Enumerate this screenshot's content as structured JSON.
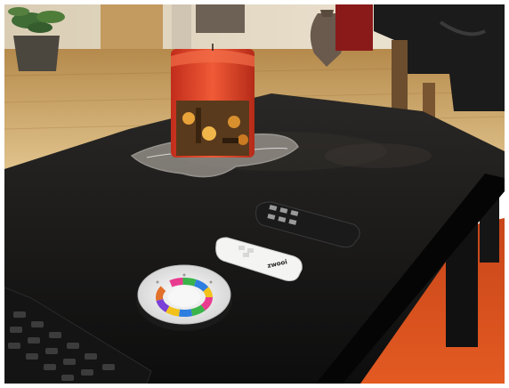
{
  "scene": {
    "remote_logo_text": "zwooi"
  },
  "colors": {
    "table": "#141414",
    "floor": "#c9a25e",
    "candle": "#e5452c",
    "rug": "#d94c1c"
  },
  "icons": [
    "candle",
    "glass-plate",
    "color-wheel-remote",
    "white-remote",
    "black-remote",
    "tv-remote",
    "plant",
    "vase"
  ]
}
